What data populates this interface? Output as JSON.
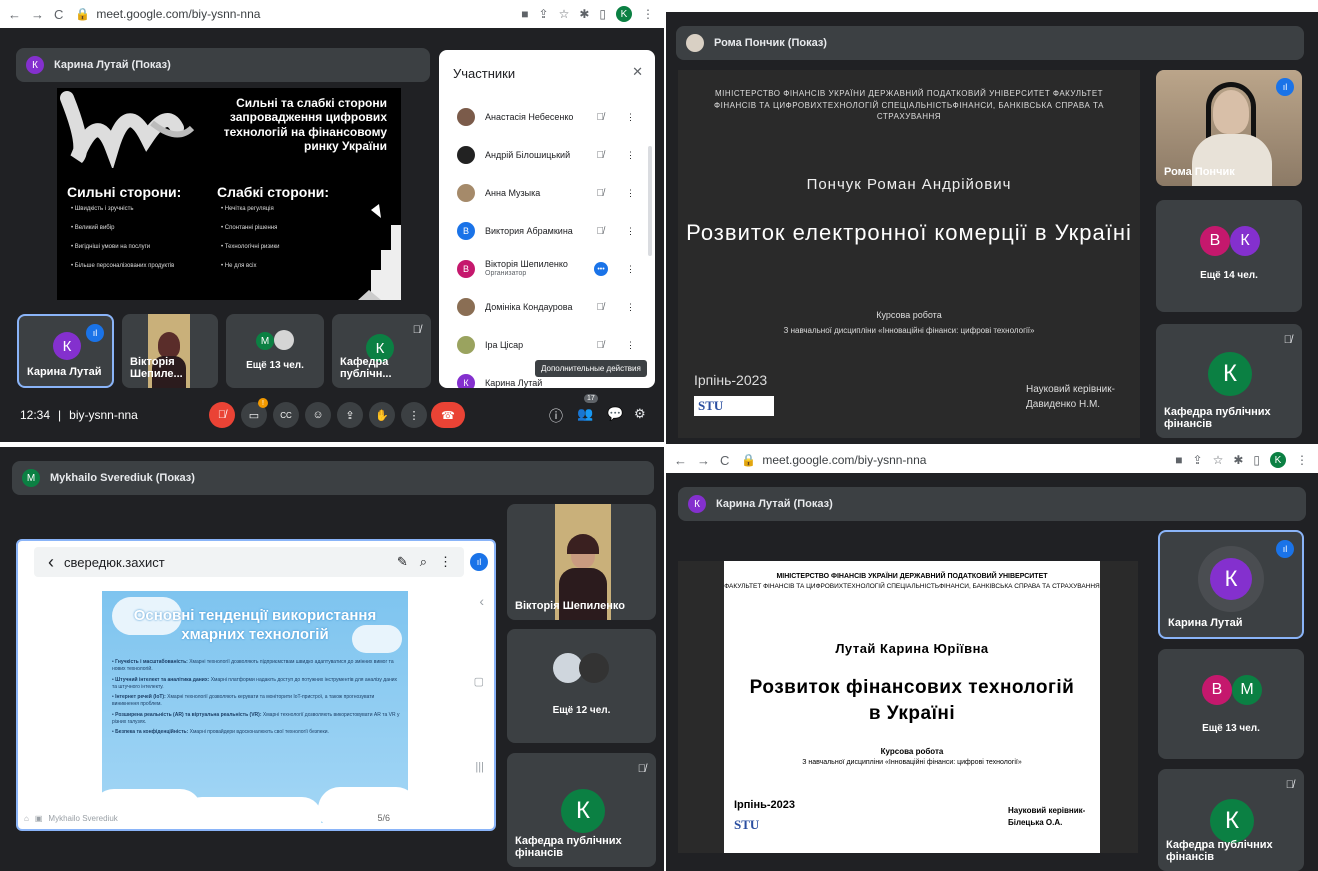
{
  "q1": {
    "browser_url": "meet.google.com/biy-ysnn-nna",
    "presenter": "Карина Лутай (Показ)",
    "presenter_initial": "К",
    "slide": {
      "title": "Сильні та слабкі сторони запровадження цифрових технологій на фінансовому ринку України",
      "strengths_title": "Сильні сторони:",
      "strengths": [
        "Швидкість і зручність",
        "Великий вибір",
        "Вигідніші умови на послуги",
        "Більше персоналізованих продуктів"
      ],
      "weaknesses_title": "Слабкі сторони:",
      "weaknesses": [
        "Нечітка регуляція",
        "Спонтанні рішення",
        "Технологічні ризики",
        "Не для всіх"
      ]
    },
    "tiles": [
      {
        "name": "Карина Лутай",
        "initial": "К"
      },
      {
        "name": "Вікторія Шепиле..."
      },
      {
        "name": "Ещё 13 чел.",
        "initial": "М"
      },
      {
        "name": "Кафедра публічн...",
        "initial": "К"
      }
    ],
    "participants_panel": {
      "title": "Участники",
      "close": "✕",
      "people": [
        {
          "name": "Анастасія Небесенко"
        },
        {
          "name": "Андрій Білошицький"
        },
        {
          "name": "Анна Музыка"
        },
        {
          "name": "Виктория Абрамкина",
          "initial": "В"
        },
        {
          "name": "Вікторія Шепиленко",
          "role": "Организатор",
          "initial": "В"
        },
        {
          "name": "Домініка Кондаурова"
        },
        {
          "name": "Іра Цісар"
        },
        {
          "name": "Карина Лутай",
          "initial": "К"
        }
      ],
      "tooltip": "Дополнительные действия"
    },
    "bottom": {
      "time": "12:34",
      "meeting_code": "biy-ysnn-nna",
      "participant_count": "17",
      "notification_count": "!"
    }
  },
  "q2": {
    "presenter": "Рома Пончик (Показ)",
    "slide": {
      "header": "МІНІСТЕРСТВО ФІНАНСІВ УКРАЇНИ ДЕРЖАВНИЙ ПОДАТКОВИЙ УНІВЕРСИТЕТ ФАКУЛЬТЕТ ФІНАНСІВ ТА ЦИФРОВИХТЕХНОЛОГІЙ СПЕЦІАЛЬНІСТЬФІНАНСИ, БАНКІВСЬКА СПРАВА ТА СТРАХУВАННЯ",
      "author": "Пончук Роман Андрійович",
      "title": "Розвиток електронної комерції в Україні",
      "type": "Курсова робота",
      "discipline": "З навчальної дисципліни «Інноваційні фінанси: цифрові технології»",
      "city_year": "Ірпінь-2023",
      "logo_text": "STU",
      "supervisor_label": "Науковий керівник-",
      "supervisor": "Давиденко Н.М."
    },
    "tiles": [
      {
        "name": "Рома Пончик"
      },
      {
        "name": "Ещё 14 чел.",
        "initials": [
          "В",
          "К"
        ]
      },
      {
        "name": "Кафедра публічних фінансів",
        "initial": "К"
      }
    ]
  },
  "q3": {
    "presenter": "Mykhailo Sverediuk (Показ)",
    "presenter_initial": "M",
    "app_title": "свередюк.захист",
    "slide": {
      "title": "Основні тенденції використання хмарних технологій",
      "bullets": [
        {
          "bold": "Гнучкість і масштабованість:",
          "text": " Хмарні технології дозволяють підприємствам швидко адаптуватися до змінних вимог та нових технологій."
        },
        {
          "bold": "Штучний інтелект та аналітика даних:",
          "text": " Хмарні платформи надають доступ до потужних інструментів для аналізу даних та штучного інтелекту."
        },
        {
          "bold": "Інтернет речей (IoT):",
          "text": " Хмарні технології дозволяють керувати та моніторити IoT-пристрої, а також прогнозувати виникнення проблем."
        },
        {
          "bold": "Розширена реальність (AR) та віртуальна реальність (VR):",
          "text": " Хмарні технології дозволяють використовувати AR та VR у різних галузях."
        },
        {
          "bold": "Безпека та конфіденційність:",
          "text": " Хмарні провайдери вдосконалюють свої технології безпеки."
        }
      ],
      "page": "5/6",
      "presenter_label": "Mykhailo Sverediuk"
    },
    "tiles": [
      {
        "name": "Вікторія Шепиленко"
      },
      {
        "name": "Ещё 12 чел."
      },
      {
        "name": "Кафедра публічних фінансів",
        "initial": "К"
      }
    ]
  },
  "q4": {
    "browser_url": "meet.google.com/biy-ysnn-nna",
    "presenter": "Карина Лутай (Показ)",
    "presenter_initial": "К",
    "slide": {
      "header1": "МІНІСТЕРСТВО ФІНАНСІВ УКРАЇНИ ДЕРЖАВНИЙ ПОДАТКОВИЙ УНІВЕРСИТЕТ",
      "header2": "ФАКУЛЬТЕТ ФІНАНСІВ ТА ЦИФРОВИХТЕХНОЛОГІЙ СПЕЦІАЛЬНІСТЬФІНАНСИ, БАНКІВСЬКА СПРАВА ТА СТРАХУВАННЯ",
      "author": "Лутай Карина Юріївна",
      "title": "Розвиток фінансових технологій в Україні",
      "type": "Курсова робота",
      "discipline": "З навчальної дисципліни «Інноваційні фінанси: цифрові технології»",
      "city_year": "Ірпінь-2023",
      "logo_text": "STU",
      "supervisor_label": "Науковий керівник-",
      "supervisor": "Білецька О.А."
    },
    "tiles": [
      {
        "name": "Карина Лутай",
        "initial": "К"
      },
      {
        "name": "Ещё 13 чел.",
        "initials": [
          "В",
          "М"
        ]
      },
      {
        "name": "Кафедра публічних фінансів",
        "initial": "К"
      }
    ]
  },
  "icons": {
    "mic_off": "🎙̸",
    "more": "⋮",
    "info": "ⓘ",
    "people": "👥",
    "chat": "💬",
    "activities": "⚙",
    "hand": "✋",
    "emoji": "☺",
    "present": "⇪",
    "cc": "CC",
    "end": "☎",
    "back": "‹",
    "edit": "✎",
    "search": "⌕"
  },
  "colors": {
    "bg": "#202124",
    "tile": "#3c4043",
    "purple": "#8430ce",
    "teal": "#0b8043",
    "blue": "#1a73e8",
    "red": "#ea4335",
    "pink": "#c5186d"
  }
}
